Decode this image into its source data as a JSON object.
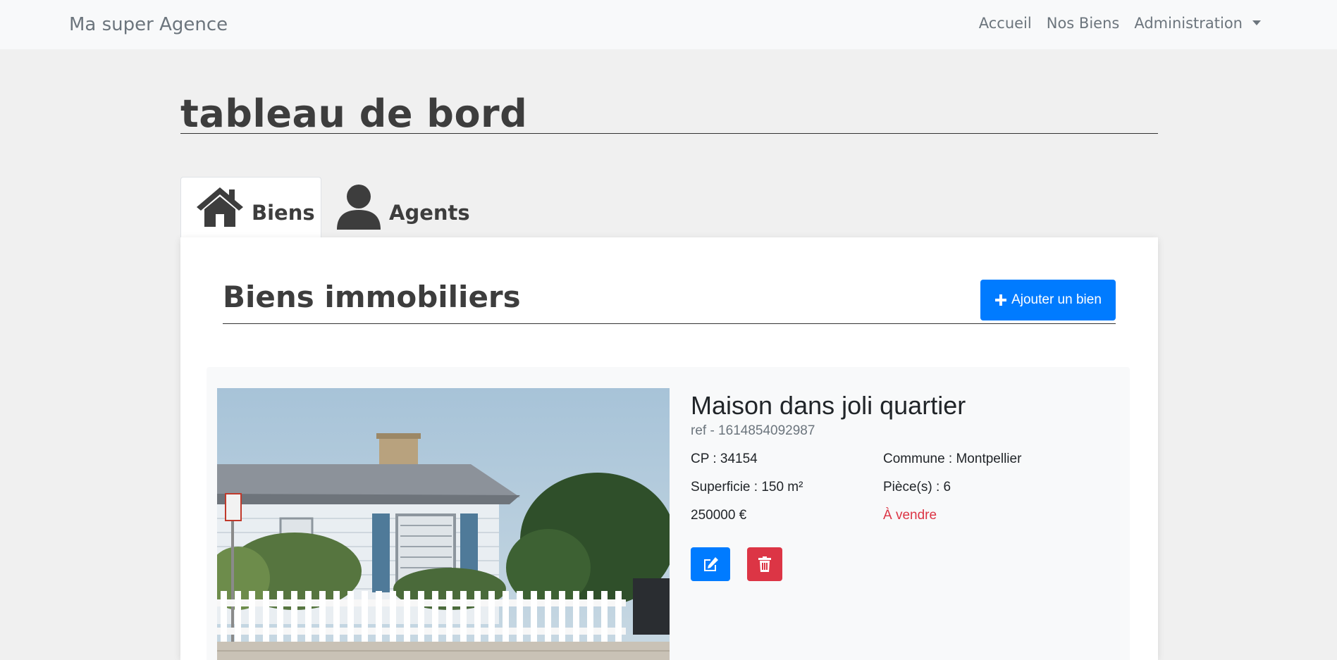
{
  "navbar": {
    "brand": "Ma super Agence",
    "links": [
      "Accueil",
      "Nos Biens",
      "Administration"
    ]
  },
  "page": {
    "title": "tableau de bord"
  },
  "tabs": [
    {
      "label": "Biens",
      "icon": "home-icon",
      "active": true
    },
    {
      "label": "Agents",
      "icon": "user-icon",
      "active": false
    }
  ],
  "panel": {
    "title": "Biens immobiliers",
    "add_button": "Ajouter un bien"
  },
  "property": {
    "title": "Maison dans joli quartier",
    "ref": "ref - 1614854092987",
    "cp": "CP : 34154",
    "commune": "Commune : Montpellier",
    "superficie": "Superficie : 150 m²",
    "pieces": "Pièce(s) : 6",
    "prix": "250000 €",
    "statut": "À vendre"
  },
  "colors": {
    "primary": "#007bff",
    "danger": "#dc3545",
    "muted": "#6c757d",
    "background": "#f0f0f0"
  }
}
